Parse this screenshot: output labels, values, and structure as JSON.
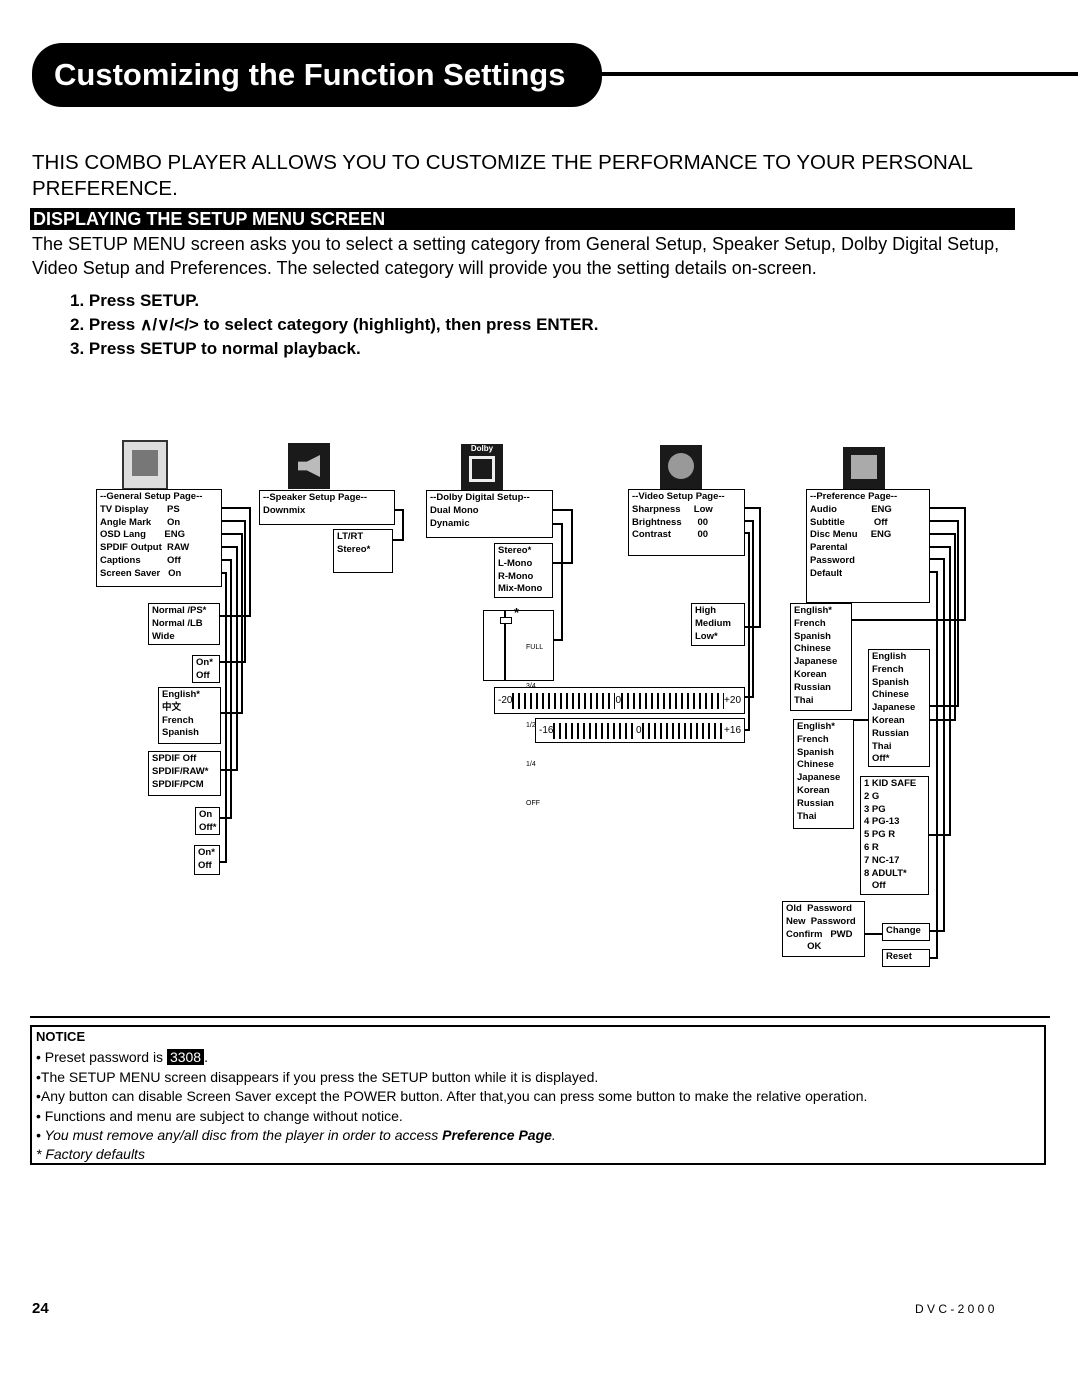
{
  "title": "Customizing the Function Settings",
  "intro": "THIS COMBO PLAYER ALLOWS YOU TO CUSTOMIZE THE PERFORMANCE TO YOUR PERSONAL PREFERENCE.",
  "section": "DISPLAYING THE SETUP MENU SCREEN",
  "description": "The SETUP MENU screen asks you to select a setting category from General Setup, Speaker Setup, Dolby Digital Setup, Video Setup and Preferences.  The selected category will provide you the setting details on-screen.",
  "steps": [
    "1. Press SETUP.",
    "2. Press ∧/∨/</>   to select category (highlight), then press ENTER.",
    "3. Press SETUP to normal playback."
  ],
  "icons": [
    "general-setup-icon",
    "speaker-setup-icon",
    "dolby-digital-icon",
    "video-setup-icon",
    "preference-icon"
  ],
  "dolby_logo": "Dolby",
  "general": {
    "menu": "--General Setup Page--\nTV Display       PS\nAngle Mark      On\nOSD Lang       ENG\nSPDIF Output  RAW\nCaptions          Off\nScreen Saver   On",
    "tv": "Normal /PS*\nNormal /LB\nWide",
    "angle": "On*\nOff",
    "osd": "English*\n中文\nFrench\nSpanish",
    "spdif": "SPDIF Off\nSPDIF/RAW*\nSPDIF/PCM",
    "captions": "On\nOff*",
    "saver": "On*\nOff"
  },
  "speaker": {
    "menu": "--Speaker Setup Page--\nDownmix",
    "downmix": "LT/RT\nStereo*"
  },
  "dolby": {
    "menu": "--Dolby Digital Setup--\nDual Mono\nDynamic",
    "dual": "Stereo*\nL-Mono\nR-Mono\nMix-Mono",
    "dynamic_levels": [
      "FULL",
      "3/4",
      "1/2",
      "1/4",
      "OFF"
    ],
    "dynamic_default": "*"
  },
  "video": {
    "menu": "--Video Setup Page--\nSharpness     Low\nBrightness      00\nContrast          00",
    "sharpness": "High\nMedium\nLow*",
    "brightness": {
      "min": "-20",
      "mid": "0",
      "max": "+20"
    },
    "contrast": {
      "min": "-16",
      "mid": "0",
      "max": "+16"
    }
  },
  "preference": {
    "menu": "--Preference Page--\nAudio             ENG\nSubtitle           Off\nDisc Menu     ENG\nParental\nPassword\nDefault",
    "audio": "English*\nFrench\nSpanish\nChinese\nJapanese\nKorean\nRussian\nThai",
    "subtitle": "English\nFrench\nSpanish\nChinese\nJapanese\nKorean\nRussian\nThai\nOff*",
    "discmenu": "English*\nFrench\nSpanish\nChinese\nJapanese\nKorean\nRussian\nThai",
    "parental": "1 KID SAFE\n2 G\n3 PG\n4 PG-13\n5 PG R\n6 R\n7 NC-17\n8 ADULT*\n   Off",
    "password": "Old  Password\nNew  Password\nConfirm   PWD\n        OK",
    "change": "Change",
    "reset": "Reset"
  },
  "notice": {
    "heading": "NOTICE",
    "pw_prefix": "• Preset password is ",
    "pw": "3308",
    "pw_suffix": ".",
    "lines": [
      "•The SETUP MENU screen disappears if you press the SETUP button while it is displayed.",
      "•Any button can disable Screen Saver except the POWER button. After that,you can press some button to make the relative operation.",
      "• Functions and menu are subject to change without notice."
    ],
    "italic_prefix": "•  You must remove any/all disc from the player in order to access  ",
    "italic_bold": "Preference Page",
    "italic_suffix": ".",
    "factory": "* Factory defaults"
  },
  "page_number": "24",
  "model": "D V C - 2 0 0 0"
}
